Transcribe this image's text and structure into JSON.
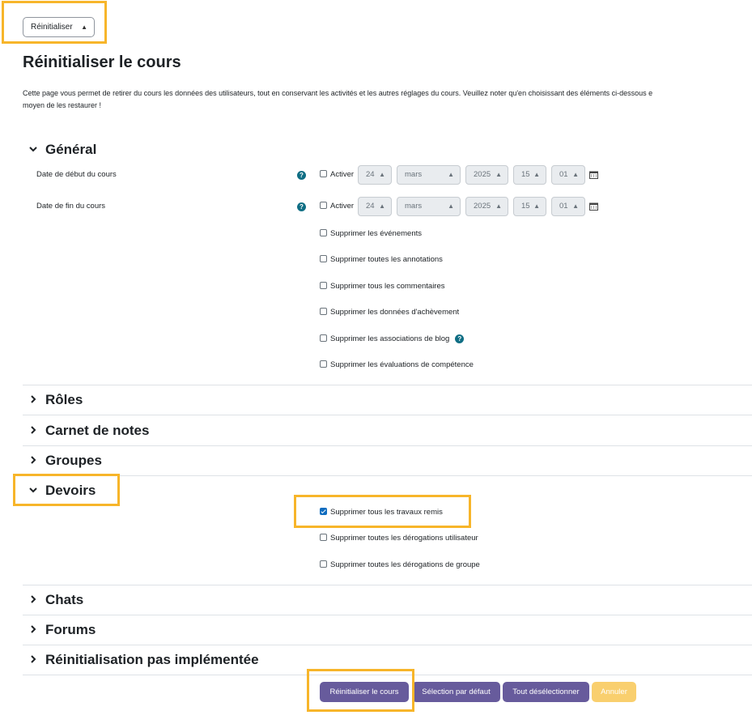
{
  "header": {
    "select_value": "Réinitialiser"
  },
  "page": {
    "title": "Réinitialiser le cours",
    "intro_line1": "Cette page vous permet de retirer du cours les données des utilisateurs, tout en conservant les activités et les autres réglages du cours. Veuillez noter qu'en choisissant des éléments ci-dessous e",
    "intro_line2": "moyen de les restaurer !"
  },
  "general": {
    "title": "Général",
    "start_label": "Date de début du cours",
    "end_label": "Date de fin du cours",
    "enable_label": "Activer",
    "start": {
      "day": "24",
      "month": "mars",
      "year": "2025",
      "hour": "15",
      "minute": "01"
    },
    "end": {
      "day": "24",
      "month": "mars",
      "year": "2025",
      "hour": "15",
      "minute": "01"
    },
    "checkboxes": [
      {
        "label": "Supprimer les événements",
        "checked": false
      },
      {
        "label": "Supprimer toutes les annotations",
        "checked": false
      },
      {
        "label": "Supprimer tous les commentaires",
        "checked": false
      },
      {
        "label": "Supprimer les données d'achèvement",
        "checked": false
      },
      {
        "label": "Supprimer les associations de blog",
        "checked": false
      },
      {
        "label": "Supprimer les évaluations de compétence",
        "checked": false
      }
    ]
  },
  "sections": {
    "roles": "Rôles",
    "gradebook": "Carnet de notes",
    "groups": "Groupes",
    "assignments": "Devoirs",
    "chats": "Chats",
    "forums": "Forums",
    "not_implemented": "Réinitialisation pas implémentée"
  },
  "assignments": {
    "checkboxes": [
      {
        "label": "Supprimer tous les travaux remis",
        "checked": true
      },
      {
        "label": "Supprimer toutes les dérogations utilisateur",
        "checked": false
      },
      {
        "label": "Supprimer toutes les dérogations de groupe",
        "checked": false
      }
    ]
  },
  "buttons": {
    "reset": "Réinitialiser le cours",
    "defaults": "Sélection par défaut",
    "deselect": "Tout désélectionner",
    "cancel": "Annuler"
  },
  "colors": {
    "highlight": "#f7b52a",
    "primary": "#675b9c",
    "help": "#0f6e84",
    "cancel": "#f9cf6e"
  },
  "icons": {
    "help": "question-circle-icon",
    "calendar": "calendar-icon",
    "expand": "chevron-icon"
  }
}
